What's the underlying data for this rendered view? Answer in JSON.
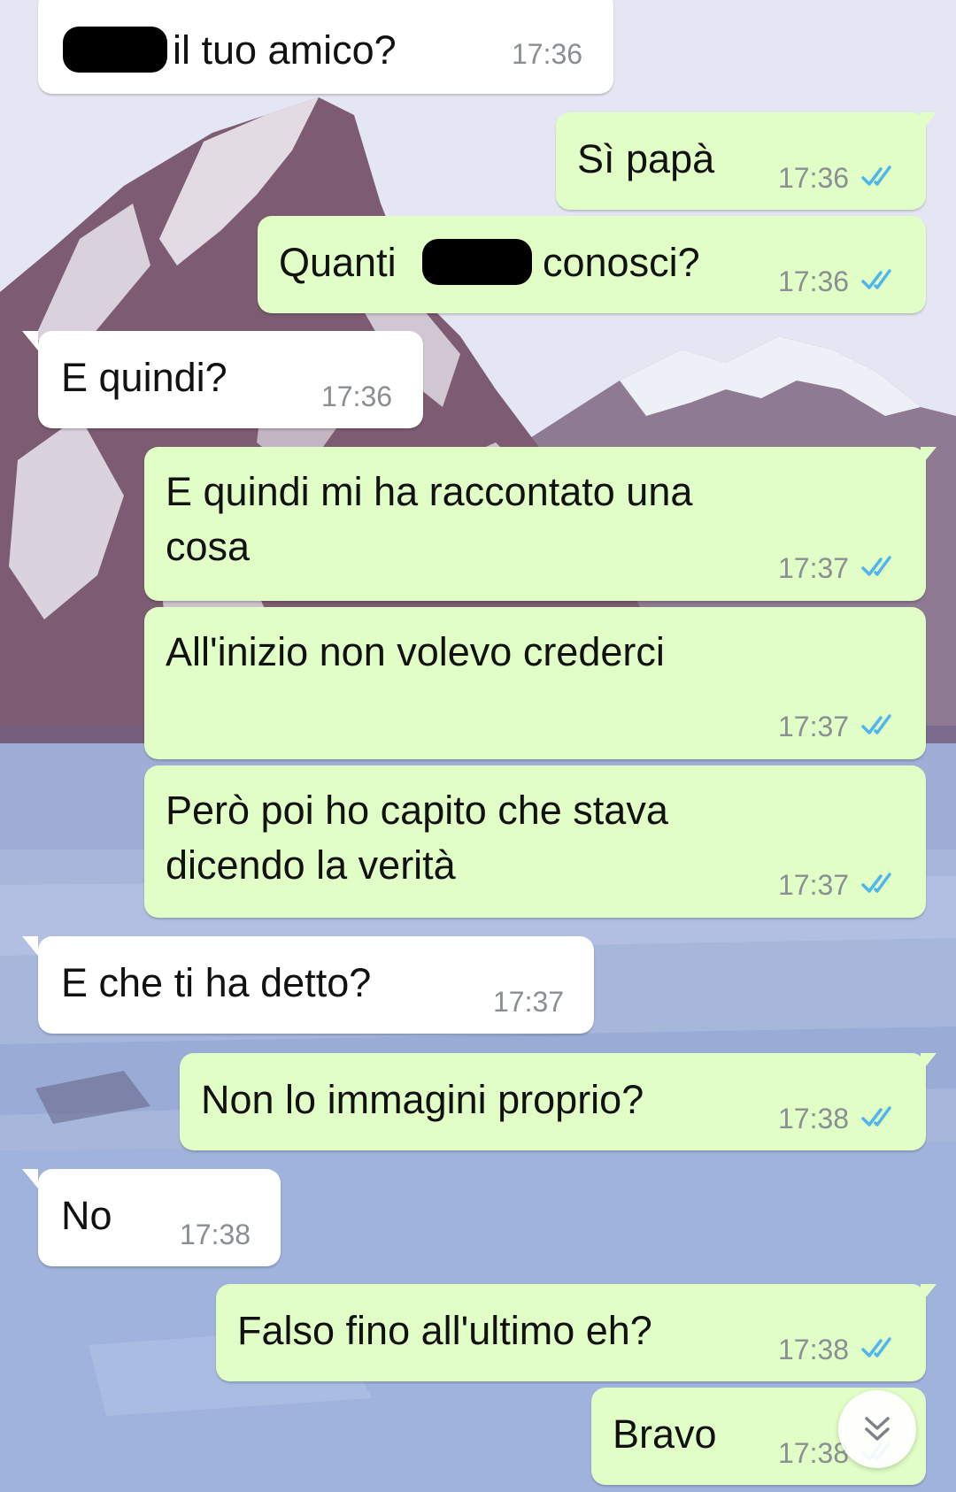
{
  "chat": {
    "messages": [
      {
        "direction": "incoming",
        "text": "il tuo amico?",
        "time": "17:36",
        "redacted": true
      },
      {
        "direction": "outgoing",
        "text": "Sì papà",
        "time": "17:36",
        "status": "read"
      },
      {
        "direction": "outgoing",
        "text_before": "Quanti",
        "text_after": "conosci?",
        "time": "17:36",
        "status": "read",
        "redacted": true
      },
      {
        "direction": "incoming",
        "text": "E quindi?",
        "time": "17:36"
      },
      {
        "direction": "outgoing",
        "lines": [
          "E quindi mi ha raccontato una",
          "cosa"
        ],
        "time": "17:37",
        "status": "read"
      },
      {
        "direction": "outgoing",
        "text": "All'inizio non volevo crederci",
        "time": "17:37",
        "status": "read"
      },
      {
        "direction": "outgoing",
        "lines": [
          "Però poi ho capito che stava",
          "dicendo la verità"
        ],
        "time": "17:37",
        "status": "read"
      },
      {
        "direction": "incoming",
        "text": "E che ti ha detto?",
        "time": "17:37"
      },
      {
        "direction": "outgoing",
        "text": "Non lo immagini proprio?",
        "time": "17:38",
        "status": "read"
      },
      {
        "direction": "incoming",
        "text": "No",
        "time": "17:38"
      },
      {
        "direction": "outgoing",
        "text": "Falso fino all'ultimo eh?",
        "time": "17:38",
        "status": "read"
      },
      {
        "direction": "outgoing",
        "text": "Bravo",
        "time": "17:38",
        "status": "read"
      }
    ]
  },
  "colors": {
    "incoming_bubble": "#ffffff",
    "outgoing_bubble": "#e1fec6",
    "read_ticks": "#4fb6ec",
    "timestamp": "#8a8f94"
  },
  "icons": {
    "read_receipt": "double-check-icon",
    "scroll_down": "double-chevron-down-icon"
  }
}
